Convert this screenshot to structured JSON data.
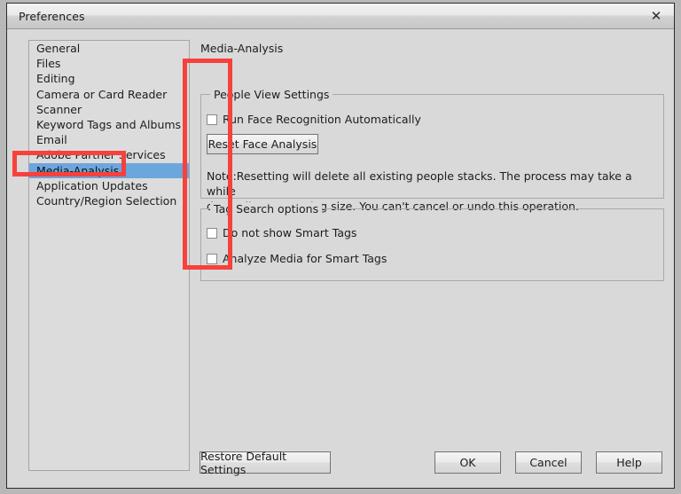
{
  "window": {
    "title": "Preferences",
    "close_icon": "close-icon",
    "close_glyph": "✕"
  },
  "sidebar": {
    "items": [
      {
        "label": "General",
        "selected": false
      },
      {
        "label": "Files",
        "selected": false
      },
      {
        "label": "Editing",
        "selected": false
      },
      {
        "label": "Camera or Card Reader",
        "selected": false
      },
      {
        "label": "Scanner",
        "selected": false
      },
      {
        "label": "Keyword Tags and Albums",
        "selected": false
      },
      {
        "label": "Email",
        "selected": false
      },
      {
        "label": "Adobe Partner Services",
        "selected": false
      },
      {
        "label": "Media-Analysis",
        "selected": true
      },
      {
        "label": "Application Updates",
        "selected": false
      },
      {
        "label": "Country/Region Selection",
        "selected": false
      }
    ]
  },
  "panel": {
    "heading": "Media-Analysis",
    "people_group": {
      "legend": "People View Settings",
      "run_face_recognition": {
        "label": "Run Face Recognition Automatically",
        "checked": false
      },
      "reset_button": "Reset Face Analysis",
      "note_line1": "Note:Resetting will delete all existing people stacks. The process may take a while",
      "note_line2": "depending on catalog size. You can't cancel or undo this operation."
    },
    "tag_group": {
      "legend": "Tag Search options",
      "do_not_show_smart_tags": {
        "label": "Do not show Smart Tags",
        "checked": false
      },
      "analyze_media_for_smart_tags": {
        "label": "Analyze Media for Smart Tags",
        "checked": false
      }
    }
  },
  "footer": {
    "restore_defaults": "Restore Default Settings",
    "ok": "OK",
    "cancel": "Cancel",
    "help": "Help"
  },
  "annotations": {
    "accent_color": "#f6413c",
    "selection_color": "#6ca6dd"
  }
}
